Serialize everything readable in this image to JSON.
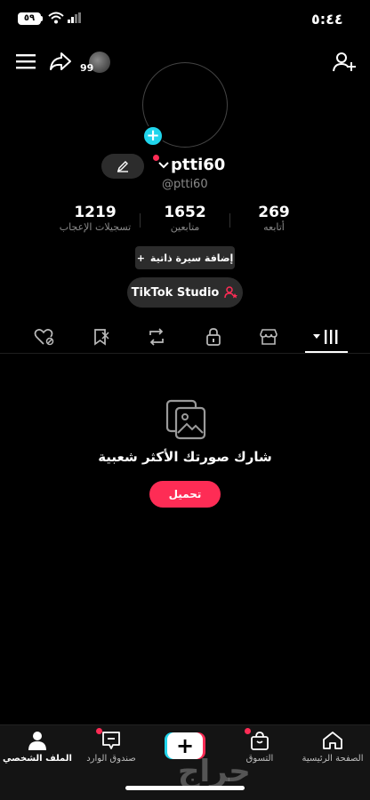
{
  "status_bar": {
    "time": "٥:٤٤",
    "battery": "٥٩"
  },
  "header": {
    "notification_count": "99"
  },
  "profile": {
    "username": "ptti60",
    "handle": "@ptti60",
    "stats": [
      {
        "value": "269",
        "label": "أتابعه"
      },
      {
        "value": "1652",
        "label": "متابعين"
      },
      {
        "value": "1219",
        "label": "تسجيلات الإعجاب"
      }
    ],
    "add_bio_label": "إضافة سيرة ذاتية",
    "studio_label": "TikTok Studio"
  },
  "tabs": [
    {
      "icon": "grid-icon",
      "active": true
    },
    {
      "icon": "shop-icon",
      "active": false
    },
    {
      "icon": "lock-icon",
      "active": false
    },
    {
      "icon": "repost-icon",
      "active": false
    },
    {
      "icon": "favorites-icon",
      "active": false
    },
    {
      "icon": "liked-icon",
      "active": false
    }
  ],
  "empty_state": {
    "title": "شارك صورتك الأكثر شعبية",
    "button_label": "تحميل"
  },
  "bottom_nav": [
    {
      "label": "الصفحة الرئيسية",
      "icon": "home-icon"
    },
    {
      "label": "التسوق",
      "icon": "shopping-bag-icon"
    },
    {
      "label": "",
      "icon": "create-plus-icon"
    },
    {
      "label": "صندوق الوارد",
      "icon": "inbox-icon"
    },
    {
      "label": "الملف الشخصي",
      "icon": "profile-icon",
      "active": true
    }
  ],
  "watermark": "حراج",
  "colors": {
    "accent": "#fe2c55",
    "cyan": "#20d5ec",
    "background": "#000000"
  }
}
